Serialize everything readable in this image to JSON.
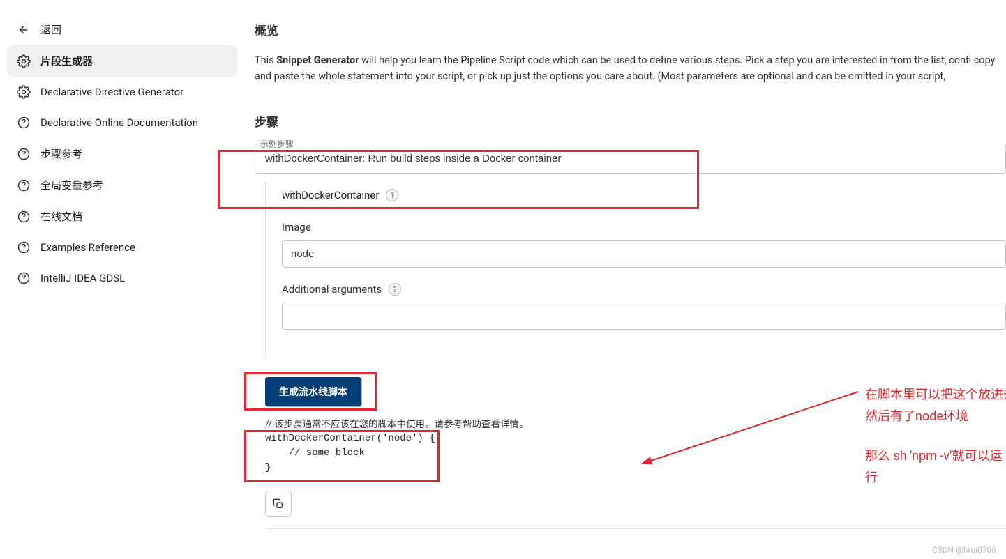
{
  "sidebar": {
    "items": [
      {
        "label": "返回",
        "icon": "back"
      },
      {
        "label": "片段生成器",
        "icon": "gear"
      },
      {
        "label": "Declarative Directive Generator",
        "icon": "gear"
      },
      {
        "label": "Declarative Online Documentation",
        "icon": "help"
      },
      {
        "label": "步骤参考",
        "icon": "help"
      },
      {
        "label": "全局变量参考",
        "icon": "help"
      },
      {
        "label": "在线文档",
        "icon": "help"
      },
      {
        "label": "Examples Reference",
        "icon": "help"
      },
      {
        "label": "IntelliJ IDEA GDSL",
        "icon": "help"
      }
    ]
  },
  "main": {
    "overview_title": "概览",
    "intro_pre": "This ",
    "intro_strong": "Snippet Generator",
    "intro_post": " will help you learn the Pipeline Script code which can be used to define various steps. Pick a step you are interested in from the list, confi copy and paste the whole statement into your script, or pick up just the options you care about. (Most parameters are optional and can be omitted in your script,",
    "steps_title": "步骤",
    "example_step_label": "示例步骤",
    "step_value": "withDockerContainer: Run build steps inside a Docker container",
    "container_label": "withDockerContainer",
    "image_label": "Image",
    "image_value": "node",
    "args_label": "Additional arguments",
    "args_value": "",
    "generate_btn": "生成流水线脚本",
    "note": "// 该步骤通常不应该在您的脚本中使用。请参考帮助查看详情。",
    "code": "withDockerContainer('node') {\n    // some block\n}",
    "watermark": "CSDN @hrui0706"
  },
  "annotations": {
    "line1": "在脚本里可以把这个放进去\n然后有了node环境",
    "line2": "那么 sh 'npm -v'就可以运行"
  }
}
